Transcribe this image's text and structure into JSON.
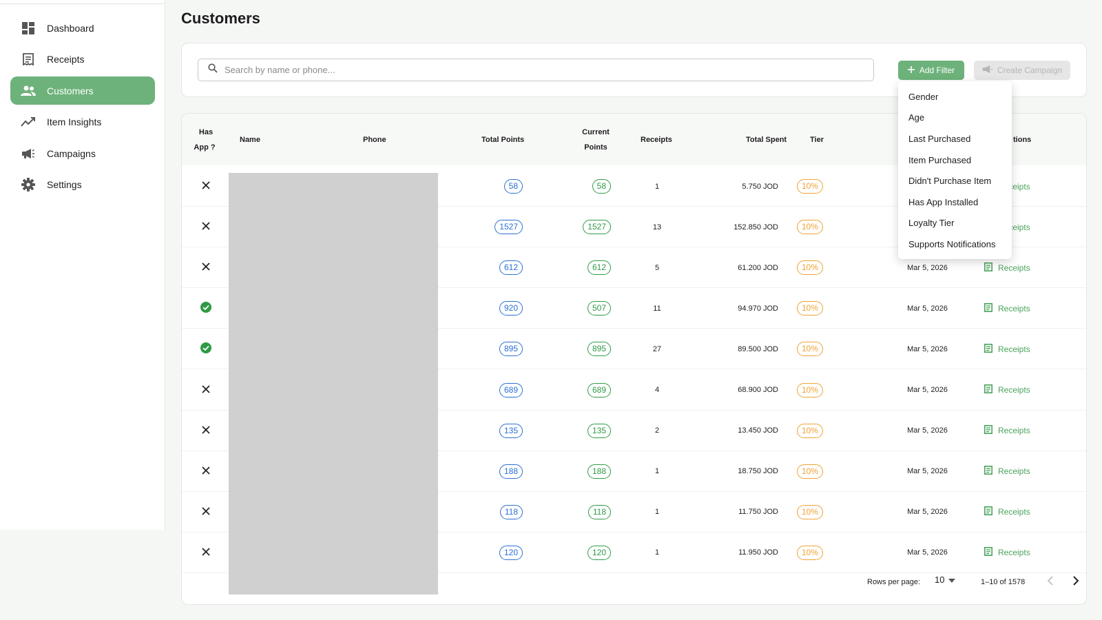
{
  "sidebar": {
    "items": [
      {
        "label": "Dashboard",
        "icon": "dashboard-icon"
      },
      {
        "label": "Receipts",
        "icon": "receipt-icon"
      },
      {
        "label": "Customers",
        "icon": "people-icon",
        "active": true
      },
      {
        "label": "Item Insights",
        "icon": "trending-icon"
      },
      {
        "label": "Campaigns",
        "icon": "megaphone-icon"
      },
      {
        "label": "Settings",
        "icon": "gear-icon"
      }
    ]
  },
  "page": {
    "title": "Customers"
  },
  "search": {
    "placeholder": "Search by name or phone..."
  },
  "toolbar": {
    "add_filter_label": "Add Filter",
    "create_campaign_label": "Create Campaign"
  },
  "filter_menu": {
    "items": [
      "Gender",
      "Age",
      "Last Purchased",
      "Item Purchased",
      "Didn't Purchase Item",
      "Has App Installed",
      "Loyalty Tier",
      "Supports Notifications"
    ]
  },
  "table": {
    "headers": {
      "has_app_1": "Has",
      "has_app_2": "App ?",
      "name": "Name",
      "phone": "Phone",
      "total_points": "Total Points",
      "current_points_1": "Current",
      "current_points_2": "Points",
      "receipts": "Receipts",
      "total_spent": "Total Spent",
      "tier": "Tier",
      "actions": "tions"
    },
    "rows": [
      {
        "has_app": false,
        "total_points": "58",
        "current_points": "58",
        "receipts": "1",
        "total_spent": "5.750 JOD",
        "tier": "10%",
        "date": "",
        "action": "Receipts"
      },
      {
        "has_app": false,
        "total_points": "1527",
        "current_points": "1527",
        "receipts": "13",
        "total_spent": "152.850 JOD",
        "tier": "10%",
        "date": "",
        "action": "Receipts"
      },
      {
        "has_app": false,
        "total_points": "612",
        "current_points": "612",
        "receipts": "5",
        "total_spent": "61.200 JOD",
        "tier": "10%",
        "date": "Mar 5, 2026",
        "action": "Receipts"
      },
      {
        "has_app": true,
        "total_points": "920",
        "current_points": "507",
        "receipts": "11",
        "total_spent": "94.970 JOD",
        "tier": "10%",
        "date": "Mar 5, 2026",
        "action": "Receipts"
      },
      {
        "has_app": true,
        "total_points": "895",
        "current_points": "895",
        "receipts": "27",
        "total_spent": "89.500 JOD",
        "tier": "10%",
        "date": "Mar 5, 2026",
        "action": "Receipts"
      },
      {
        "has_app": false,
        "total_points": "689",
        "current_points": "689",
        "receipts": "4",
        "total_spent": "68.900 JOD",
        "tier": "10%",
        "date": "Mar 5, 2026",
        "action": "Receipts"
      },
      {
        "has_app": false,
        "total_points": "135",
        "current_points": "135",
        "receipts": "2",
        "total_spent": "13.450 JOD",
        "tier": "10%",
        "date": "Mar 5, 2026",
        "action": "Receipts"
      },
      {
        "has_app": false,
        "total_points": "188",
        "current_points": "188",
        "receipts": "1",
        "total_spent": "18.750 JOD",
        "tier": "10%",
        "date": "Mar 5, 2026",
        "action": "Receipts"
      },
      {
        "has_app": false,
        "total_points": "118",
        "current_points": "118",
        "receipts": "1",
        "total_spent": "11.750 JOD",
        "tier": "10%",
        "date": "Mar 5, 2026",
        "action": "Receipts"
      },
      {
        "has_app": false,
        "total_points": "120",
        "current_points": "120",
        "receipts": "1",
        "total_spent": "11.950 JOD",
        "tier": "10%",
        "date": "Mar 5, 2026",
        "action": "Receipts"
      }
    ]
  },
  "pagination": {
    "rows_per_page_label": "Rows per page:",
    "rows_per_page": "10",
    "range": "1–10 of 1578"
  },
  "colors": {
    "accent": "#6db27b",
    "blue": "#2a6fd6",
    "green": "#2e9a45",
    "orange": "#f0a232"
  }
}
